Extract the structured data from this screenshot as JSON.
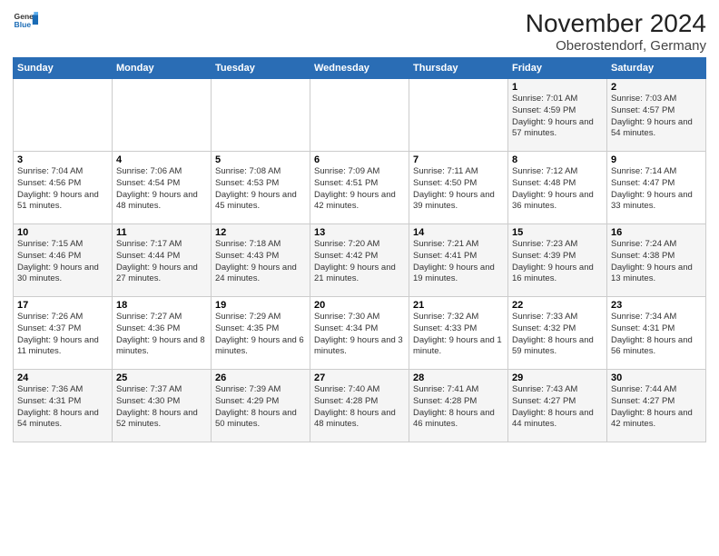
{
  "logo": {
    "line1": "General",
    "line2": "Blue"
  },
  "title": "November 2024",
  "location": "Oberostendorf, Germany",
  "headers": [
    "Sunday",
    "Monday",
    "Tuesday",
    "Wednesday",
    "Thursday",
    "Friday",
    "Saturday"
  ],
  "weeks": [
    [
      {
        "day": "",
        "detail": ""
      },
      {
        "day": "",
        "detail": ""
      },
      {
        "day": "",
        "detail": ""
      },
      {
        "day": "",
        "detail": ""
      },
      {
        "day": "",
        "detail": ""
      },
      {
        "day": "1",
        "detail": "Sunrise: 7:01 AM\nSunset: 4:59 PM\nDaylight: 9 hours and 57 minutes."
      },
      {
        "day": "2",
        "detail": "Sunrise: 7:03 AM\nSunset: 4:57 PM\nDaylight: 9 hours and 54 minutes."
      }
    ],
    [
      {
        "day": "3",
        "detail": "Sunrise: 7:04 AM\nSunset: 4:56 PM\nDaylight: 9 hours and 51 minutes."
      },
      {
        "day": "4",
        "detail": "Sunrise: 7:06 AM\nSunset: 4:54 PM\nDaylight: 9 hours and 48 minutes."
      },
      {
        "day": "5",
        "detail": "Sunrise: 7:08 AM\nSunset: 4:53 PM\nDaylight: 9 hours and 45 minutes."
      },
      {
        "day": "6",
        "detail": "Sunrise: 7:09 AM\nSunset: 4:51 PM\nDaylight: 9 hours and 42 minutes."
      },
      {
        "day": "7",
        "detail": "Sunrise: 7:11 AM\nSunset: 4:50 PM\nDaylight: 9 hours and 39 minutes."
      },
      {
        "day": "8",
        "detail": "Sunrise: 7:12 AM\nSunset: 4:48 PM\nDaylight: 9 hours and 36 minutes."
      },
      {
        "day": "9",
        "detail": "Sunrise: 7:14 AM\nSunset: 4:47 PM\nDaylight: 9 hours and 33 minutes."
      }
    ],
    [
      {
        "day": "10",
        "detail": "Sunrise: 7:15 AM\nSunset: 4:46 PM\nDaylight: 9 hours and 30 minutes."
      },
      {
        "day": "11",
        "detail": "Sunrise: 7:17 AM\nSunset: 4:44 PM\nDaylight: 9 hours and 27 minutes."
      },
      {
        "day": "12",
        "detail": "Sunrise: 7:18 AM\nSunset: 4:43 PM\nDaylight: 9 hours and 24 minutes."
      },
      {
        "day": "13",
        "detail": "Sunrise: 7:20 AM\nSunset: 4:42 PM\nDaylight: 9 hours and 21 minutes."
      },
      {
        "day": "14",
        "detail": "Sunrise: 7:21 AM\nSunset: 4:41 PM\nDaylight: 9 hours and 19 minutes."
      },
      {
        "day": "15",
        "detail": "Sunrise: 7:23 AM\nSunset: 4:39 PM\nDaylight: 9 hours and 16 minutes."
      },
      {
        "day": "16",
        "detail": "Sunrise: 7:24 AM\nSunset: 4:38 PM\nDaylight: 9 hours and 13 minutes."
      }
    ],
    [
      {
        "day": "17",
        "detail": "Sunrise: 7:26 AM\nSunset: 4:37 PM\nDaylight: 9 hours and 11 minutes."
      },
      {
        "day": "18",
        "detail": "Sunrise: 7:27 AM\nSunset: 4:36 PM\nDaylight: 9 hours and 8 minutes."
      },
      {
        "day": "19",
        "detail": "Sunrise: 7:29 AM\nSunset: 4:35 PM\nDaylight: 9 hours and 6 minutes."
      },
      {
        "day": "20",
        "detail": "Sunrise: 7:30 AM\nSunset: 4:34 PM\nDaylight: 9 hours and 3 minutes."
      },
      {
        "day": "21",
        "detail": "Sunrise: 7:32 AM\nSunset: 4:33 PM\nDaylight: 9 hours and 1 minute."
      },
      {
        "day": "22",
        "detail": "Sunrise: 7:33 AM\nSunset: 4:32 PM\nDaylight: 8 hours and 59 minutes."
      },
      {
        "day": "23",
        "detail": "Sunrise: 7:34 AM\nSunset: 4:31 PM\nDaylight: 8 hours and 56 minutes."
      }
    ],
    [
      {
        "day": "24",
        "detail": "Sunrise: 7:36 AM\nSunset: 4:31 PM\nDaylight: 8 hours and 54 minutes."
      },
      {
        "day": "25",
        "detail": "Sunrise: 7:37 AM\nSunset: 4:30 PM\nDaylight: 8 hours and 52 minutes."
      },
      {
        "day": "26",
        "detail": "Sunrise: 7:39 AM\nSunset: 4:29 PM\nDaylight: 8 hours and 50 minutes."
      },
      {
        "day": "27",
        "detail": "Sunrise: 7:40 AM\nSunset: 4:28 PM\nDaylight: 8 hours and 48 minutes."
      },
      {
        "day": "28",
        "detail": "Sunrise: 7:41 AM\nSunset: 4:28 PM\nDaylight: 8 hours and 46 minutes."
      },
      {
        "day": "29",
        "detail": "Sunrise: 7:43 AM\nSunset: 4:27 PM\nDaylight: 8 hours and 44 minutes."
      },
      {
        "day": "30",
        "detail": "Sunrise: 7:44 AM\nSunset: 4:27 PM\nDaylight: 8 hours and 42 minutes."
      }
    ]
  ]
}
